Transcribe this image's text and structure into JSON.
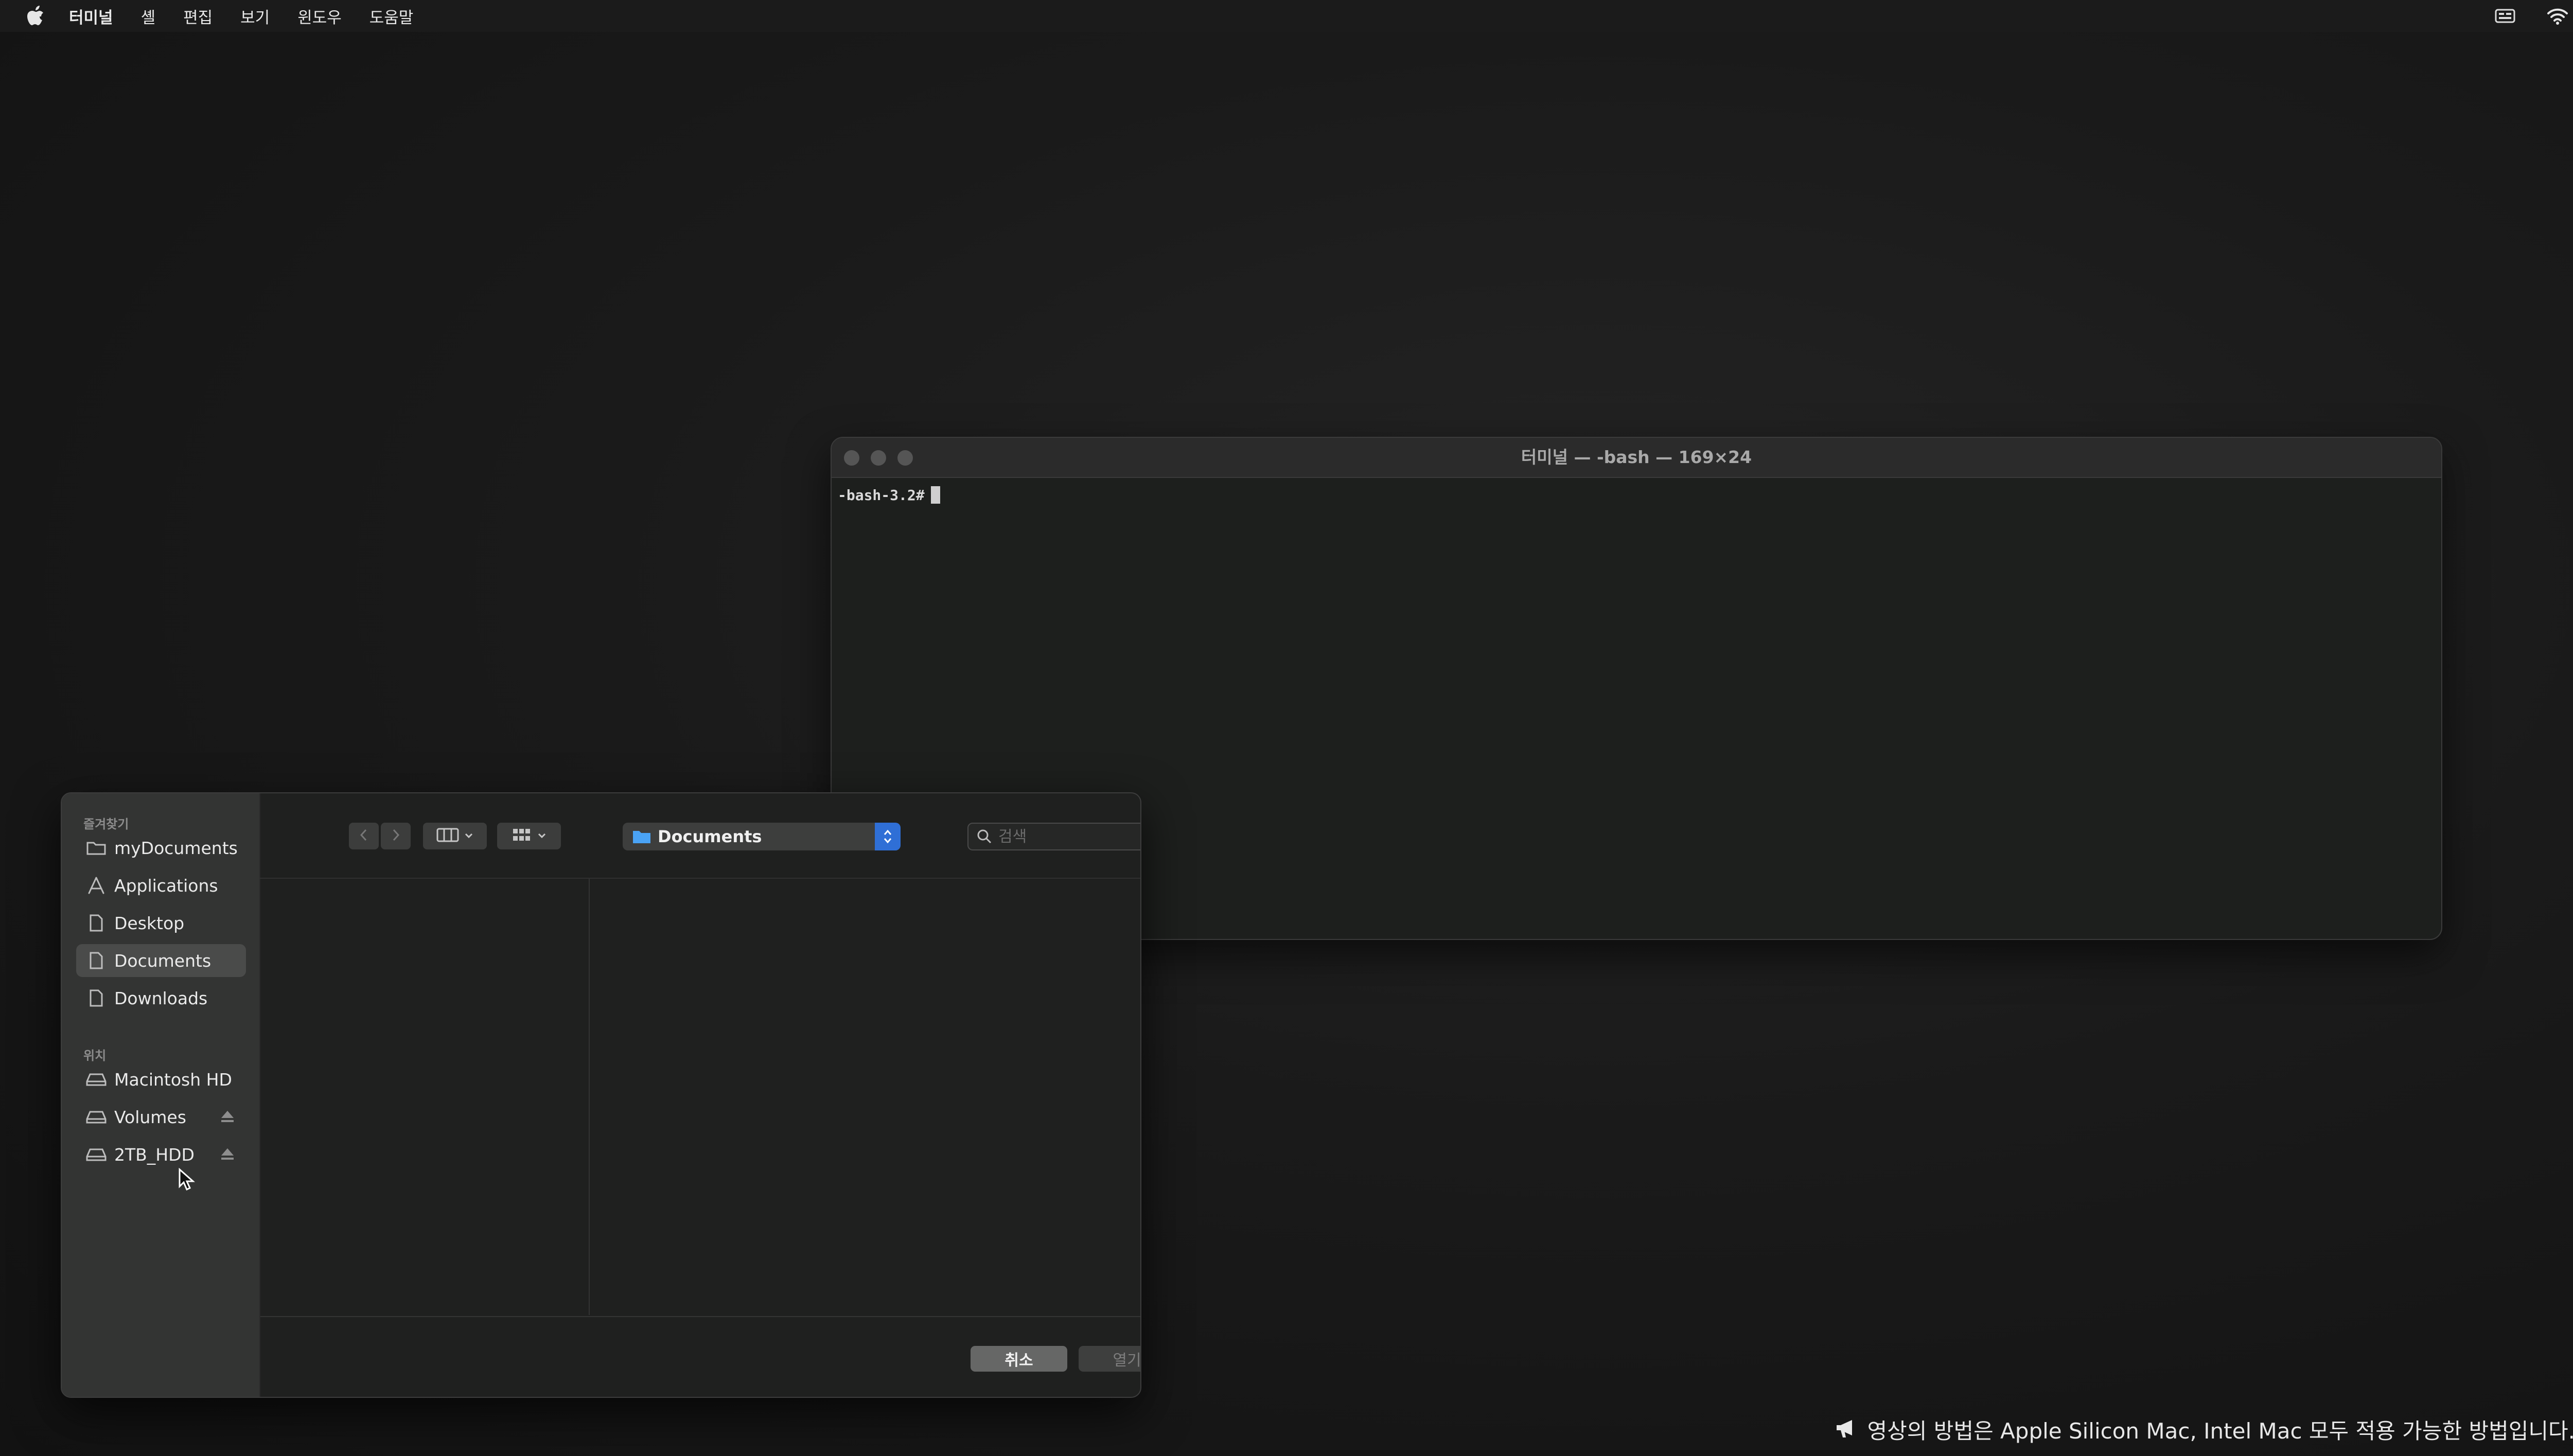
{
  "menubar": {
    "app_name": "터미널",
    "items": [
      "셸",
      "편집",
      "보기",
      "윈도우",
      "도움말"
    ]
  },
  "terminal": {
    "title": "터미널 — -bash — 169×24",
    "prompt": "-bash-3.2#"
  },
  "dialog": {
    "sidebar": {
      "favorites_heading": "즐겨찾기",
      "favorites": [
        {
          "label": "myDocuments",
          "icon": "folder-icon"
        },
        {
          "label": "Applications",
          "icon": "applications-icon"
        },
        {
          "label": "Desktop",
          "icon": "document-icon"
        },
        {
          "label": "Documents",
          "icon": "document-icon"
        },
        {
          "label": "Downloads",
          "icon": "document-icon"
        }
      ],
      "locations_heading": "위치",
      "locations": [
        {
          "label": "Macintosh HD",
          "icon": "drive-icon"
        },
        {
          "label": "Volumes",
          "icon": "drive-icon"
        },
        {
          "label": "2TB_HDD",
          "icon": "drive-icon"
        }
      ]
    },
    "path": "Documents",
    "search_placeholder": "검색",
    "cancel_label": "취소",
    "open_label": "열기"
  },
  "caption": {
    "text": "영상의 방법은 Apple Silicon Mac, Intel Mac 모두 적용 가능한 방법입니다."
  },
  "colors": {
    "accent": "#2f6fd6",
    "window_bg": "#1d1f1d",
    "sidebar_bg": "#333433"
  }
}
